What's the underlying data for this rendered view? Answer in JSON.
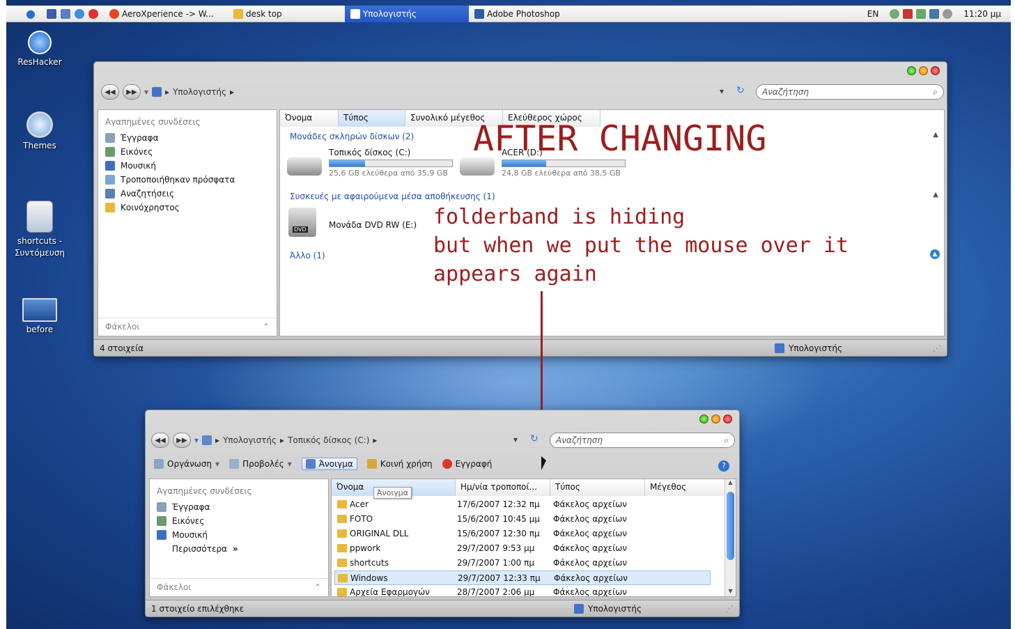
{
  "taskbar": {
    "apple": "",
    "items": [
      {
        "label": "AeroXperience -> W..."
      },
      {
        "label": "desk top"
      },
      {
        "label": "Υπολογιστής"
      },
      {
        "label": "Adobe Photoshop"
      }
    ],
    "lang": "EN",
    "time": "11:20 μμ"
  },
  "desktop_icons": [
    {
      "label": "ResHacker"
    },
    {
      "label": "Themes"
    },
    {
      "label": "shortcuts - Συντόμευση"
    },
    {
      "label": "before"
    }
  ],
  "top_window": {
    "breadcrumb": "Υπολογιστής",
    "search_placeholder": "Αναζήτηση",
    "nav_header": "Αγαπημένες συνδέσεις",
    "nav_items": [
      "Έγγραφα",
      "Εικόνες",
      "Μουσική",
      "Τροποποιήθηκαν πρόσφατα",
      "Αναζητήσεις",
      "Κοινόχρηστος"
    ],
    "folders_label": "Φάκελοι",
    "columns": [
      "Όνομα",
      "Τύπος",
      "Συνολικό μέγεθος",
      "Ελεύθερος χώρος"
    ],
    "group_hdd": "Μονάδες σκληρών δίσκων (2)",
    "drive_c": {
      "name": "Τοπικός δίσκος (C:)",
      "free": "25,6 GB ελεύθερα από 35,9 GB",
      "used_fraction": 0.29
    },
    "drive_d": {
      "name": "ACER (D:)",
      "free": "24,8 GB ελεύθερα από 38,5 GB",
      "used_fraction": 0.36
    },
    "group_removable": "Συσκευές με αφαιρούμενα μέσα αποθήκευσης (1)",
    "dvd": "Μονάδα DVD RW (E:)",
    "group_other": "Άλλο (1)",
    "status_count": "4 στοιχεία",
    "status_location": "Υπολογιστής"
  },
  "annotation": {
    "heading": "AFTER CHANGING",
    "line1": "folderband is hiding",
    "line2": "but when we put the mouse over it",
    "line3": "appears again"
  },
  "bottom_window": {
    "breadcrumb_1": "Υπολογιστής",
    "breadcrumb_2": "Τοπικός δίσκος (C:)",
    "search_placeholder": "Αναζήτηση",
    "toolbar": {
      "organize": "Οργάνωση",
      "views": "Προβολές",
      "open": "Άνοιγμα",
      "share": "Κοινή χρήση",
      "burn": "Εγγραφή"
    },
    "nav_header": "Αγαπημένες συνδέσεις",
    "nav_items": [
      "Έγγραφα",
      "Εικόνες",
      "Μουσική"
    ],
    "more": "Περισσότερα",
    "more_glyph": "»",
    "folders_label": "Φάκελοι",
    "columns": [
      "Όνομα",
      "Ημ/νία τροποποί...",
      "Τύπος",
      "Μέγεθος"
    ],
    "tooltip": "Άνοιγμα",
    "rows": [
      {
        "name": "Acer",
        "date": "17/6/2007 12:32 πμ",
        "type": "Φάκελος αρχείων"
      },
      {
        "name": "FOTO",
        "date": "15/6/2007 10:45 μμ",
        "type": "Φάκελος αρχείων"
      },
      {
        "name": "ORIGINAL DLL",
        "date": "15/6/2007 12:30 πμ",
        "type": "Φάκελος αρχείων"
      },
      {
        "name": "ppwork",
        "date": "29/7/2007 9:53 μμ",
        "type": "Φάκελος αρχείων"
      },
      {
        "name": "shortcuts",
        "date": "29/7/2007 1:00 πμ",
        "type": "Φάκελος αρχείων"
      },
      {
        "name": "Windows",
        "date": "29/7/2007 12:33 πμ",
        "type": "Φάκελος αρχείων"
      },
      {
        "name": "Αρχεία Εφαρμογών",
        "date": "28/7/2007 2:06 μμ",
        "type": "Φάκελος αρχείων"
      }
    ],
    "status_selected": "1 στοιχείο επιλέχθηκε",
    "status_location": "Υπολογιστής"
  },
  "colors": {
    "annotation": "#9c1e1e",
    "link": "#1d4ea8",
    "desktop": "#2c62ad"
  }
}
